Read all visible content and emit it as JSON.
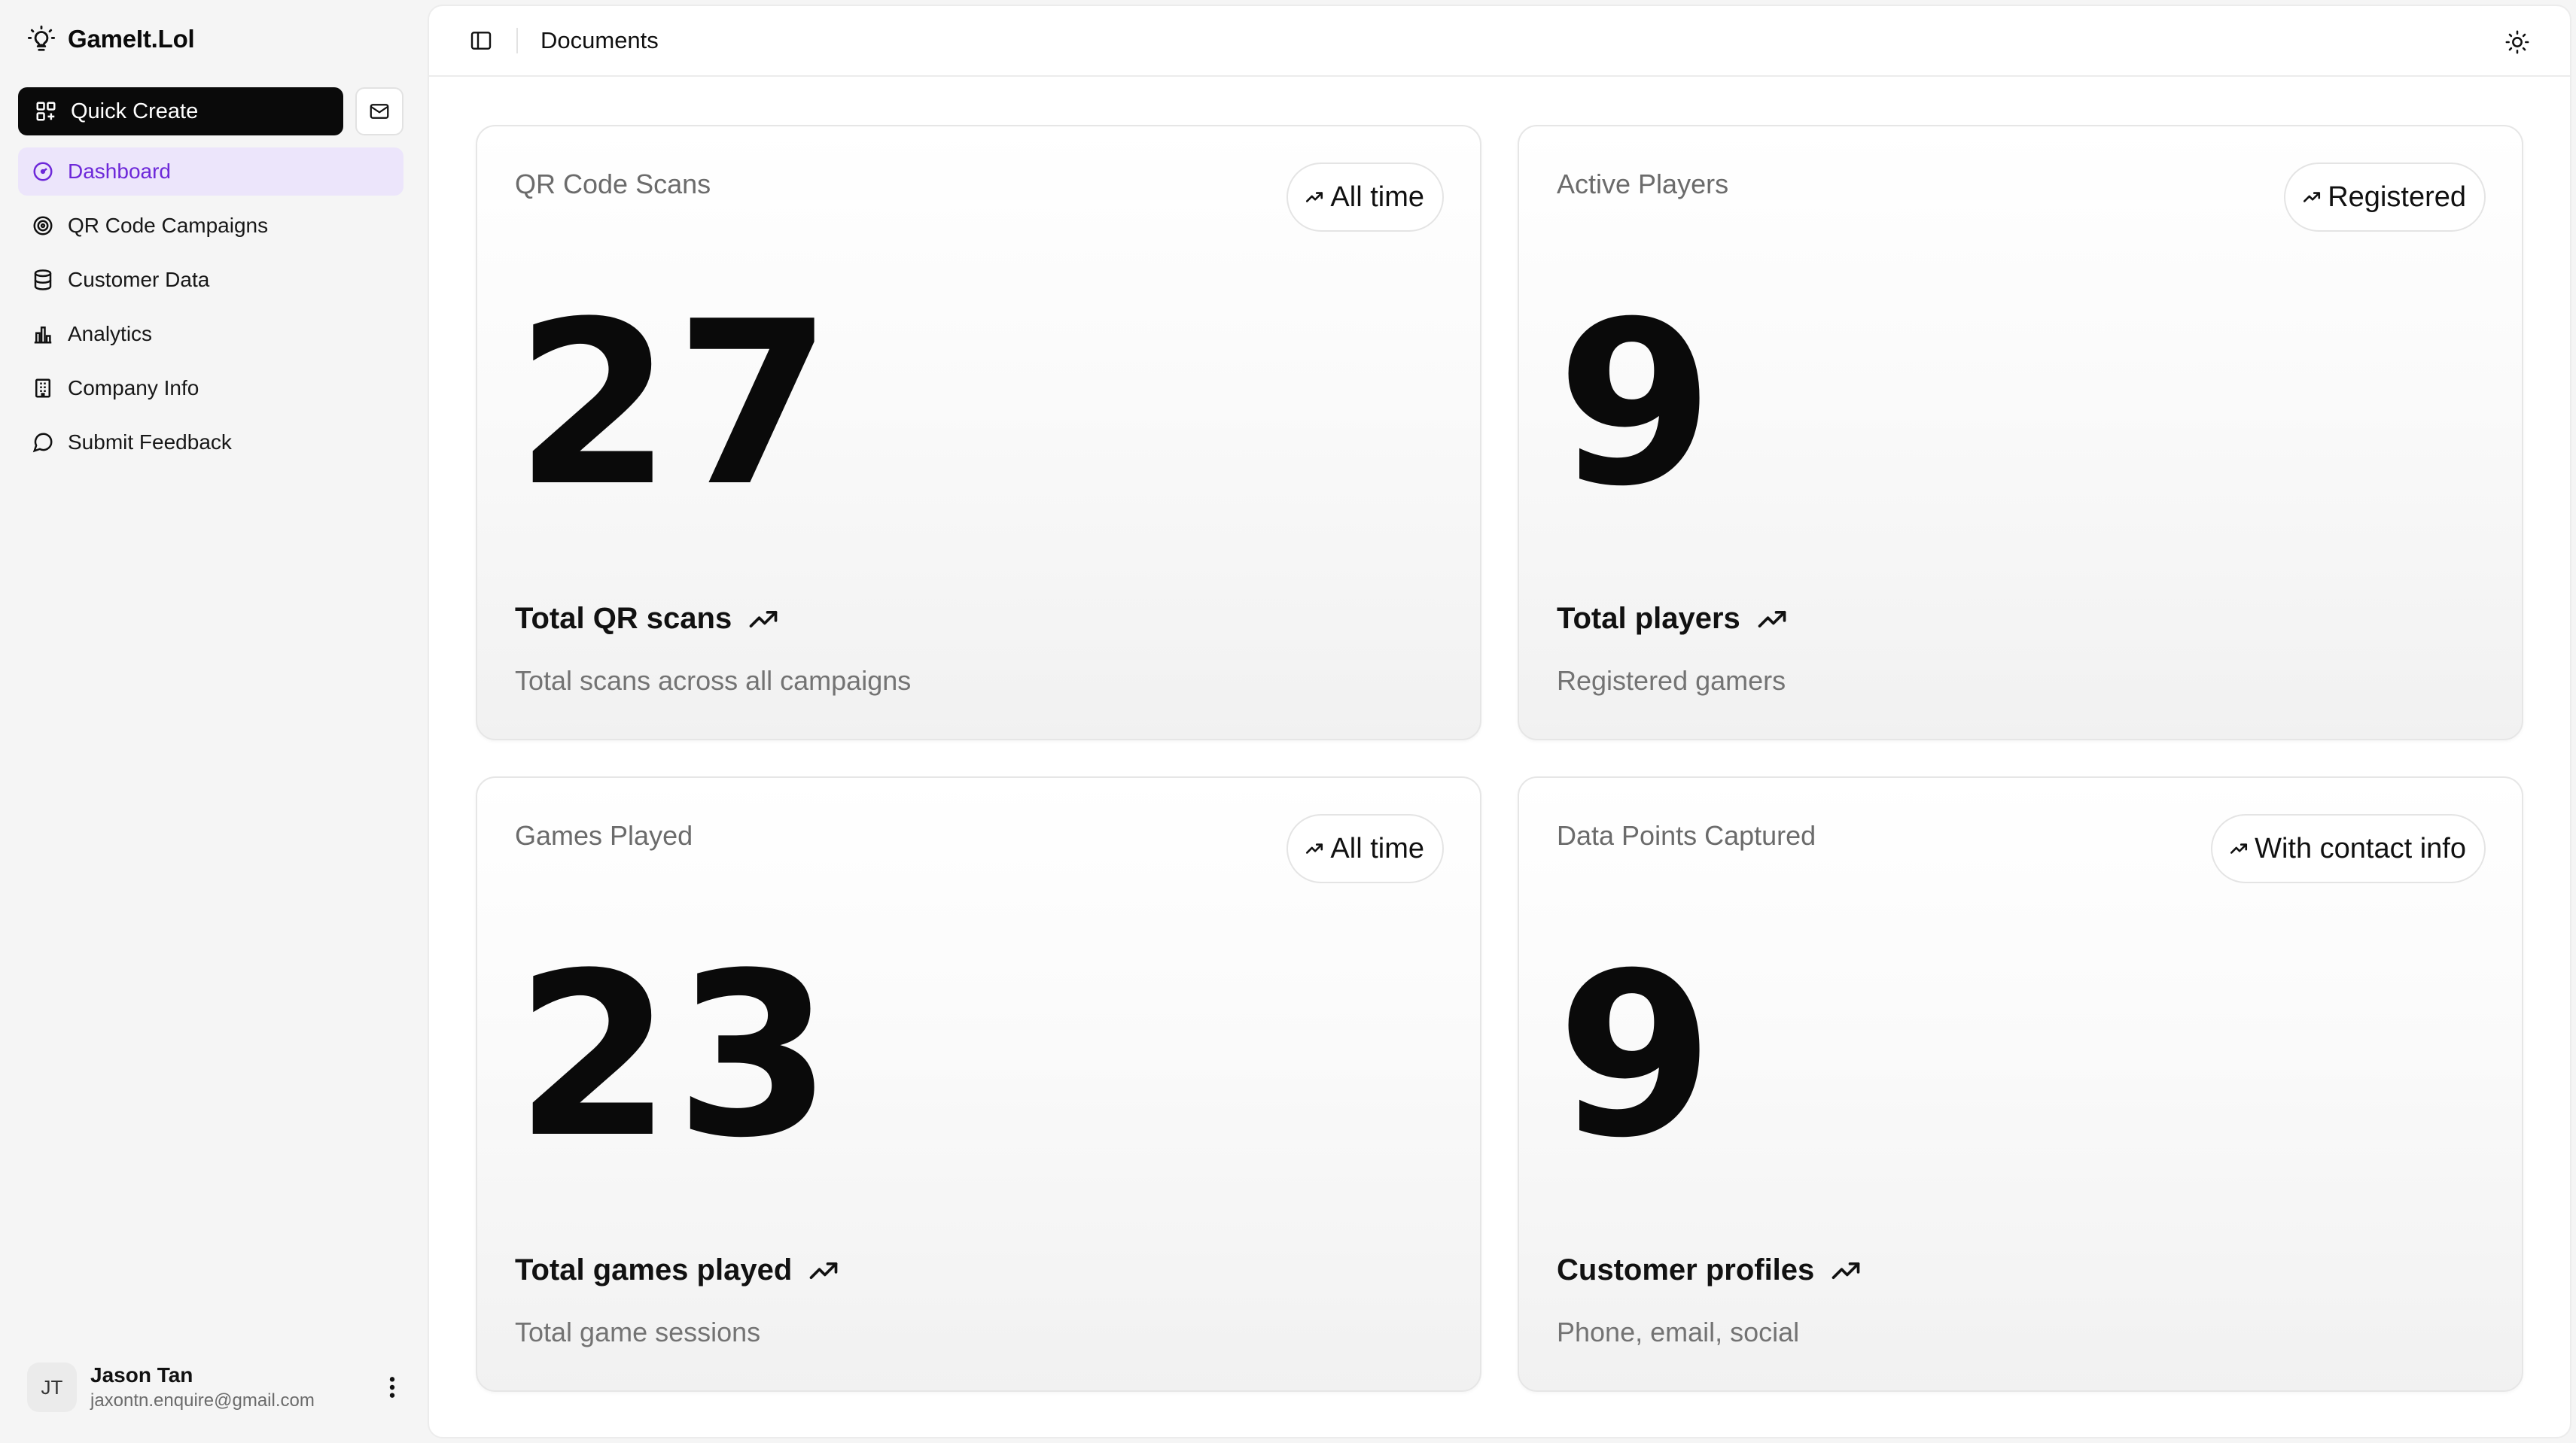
{
  "app": {
    "brand_name": "GameIt.Lol",
    "brand_icon": "lightbulb-icon"
  },
  "sidebar": {
    "quick_create_label": "Quick Create",
    "inbox_icon": "mail-icon",
    "items": [
      {
        "label": "Dashboard",
        "icon": "dashboard-gauge-icon",
        "active": true
      },
      {
        "label": "QR Code Campaigns",
        "icon": "target-icon",
        "active": false
      },
      {
        "label": "Customer Data",
        "icon": "database-icon",
        "active": false
      },
      {
        "label": "Analytics",
        "icon": "bar-chart-icon",
        "active": false
      },
      {
        "label": "Company Info",
        "icon": "building-icon",
        "active": false
      },
      {
        "label": "Submit Feedback",
        "icon": "message-circle-icon",
        "active": false
      }
    ],
    "user": {
      "initials": "JT",
      "name": "Jason Tan",
      "email": "jaxontn.enquire@gmail.com"
    }
  },
  "header": {
    "title": "Documents",
    "theme_icon": "sun-icon"
  },
  "cards": [
    {
      "label": "QR Code Scans",
      "badge": "All time",
      "value": "27",
      "title": "Total QR scans",
      "description": "Total scans across all campaigns"
    },
    {
      "label": "Active Players",
      "badge": "Registered",
      "value": "9",
      "title": "Total players",
      "description": "Registered gamers"
    },
    {
      "label": "Games Played",
      "badge": "All time",
      "value": "23",
      "title": "Total games played",
      "description": "Total game sessions"
    },
    {
      "label": "Data Points Captured",
      "badge": "With contact info",
      "value": "9",
      "title": "Customer profiles",
      "description": "Phone, email, social"
    }
  ],
  "colors": {
    "accent": "#6d28d9",
    "active_bg": "#ece5fb",
    "primary_button": "#0a0a0a"
  }
}
